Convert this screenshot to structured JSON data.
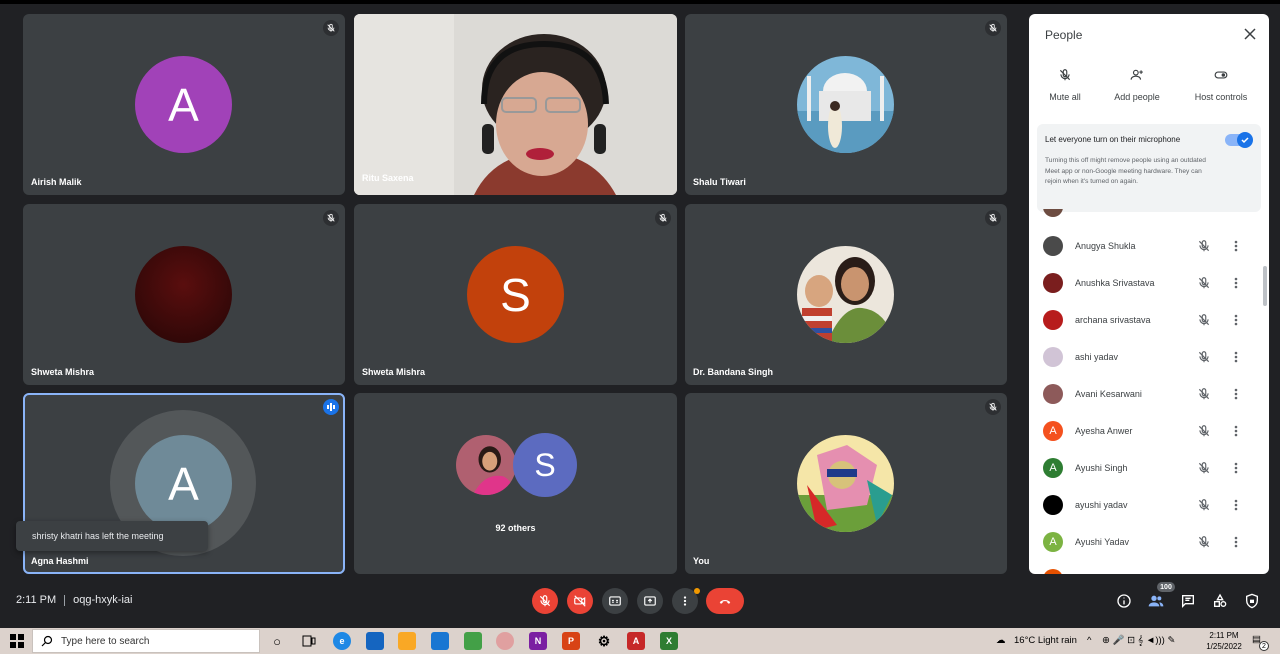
{
  "tiles": [
    {
      "name": "Airish Malik",
      "initial": "A",
      "color": "#a142b8"
    },
    {
      "name": "Ritu Saxena"
    },
    {
      "name": "Shalu Tiwari"
    },
    {
      "name": "Shweta Mishra",
      "color": "#5a0e0e"
    },
    {
      "name": "Shweta Mishra",
      "initial": "S",
      "color": "#c2410c"
    },
    {
      "name": "Dr. Bandana Singh"
    },
    {
      "name": "Agna Hashmi",
      "initial": "A",
      "color": "#6f8a98"
    },
    {
      "others": "92 others",
      "initial": "S",
      "color": "#5c6bc0"
    },
    {
      "name": "You"
    }
  ],
  "toast": "shristy khatri has left the meeting",
  "meeting": {
    "time": "2:11 PM",
    "code": "oqg-hxyk-iai"
  },
  "participants_badge": "100",
  "panel": {
    "title": "People",
    "actions": [
      {
        "label": "Mute all",
        "icon": "mic-off-icon"
      },
      {
        "label": "Add people",
        "icon": "person-add-icon"
      },
      {
        "label": "Host controls",
        "icon": "toggle-icon"
      }
    ],
    "mic_setting": {
      "label": "Let everyone turn on their microphone",
      "description": "Turning this off might remove people using an outdated Meet app or non-Google meeting hardware. They can rejoin when it's turned on again.",
      "enabled": true
    },
    "people": [
      {
        "name": "Anugya Shukla",
        "color": "#4a4a4a",
        "initial": ""
      },
      {
        "name": "Anushka Srivastava",
        "color": "#7a1e1e",
        "initial": ""
      },
      {
        "name": "archana srivastava",
        "color": "#b71c1c",
        "initial": ""
      },
      {
        "name": "ashi yadav",
        "color": "#d1c4d6",
        "initial": ""
      },
      {
        "name": "Avani Kesarwani",
        "color": "#8d5a5a",
        "initial": ""
      },
      {
        "name": "Ayesha Anwer",
        "color": "#f4511e",
        "initial": "A"
      },
      {
        "name": "Ayushi Singh",
        "color": "#2e7d32",
        "initial": "A"
      },
      {
        "name": "ayushi yadav",
        "color": "#000000",
        "initial": ""
      },
      {
        "name": "Ayushi Yadav",
        "color": "#7cb342",
        "initial": "A"
      }
    ]
  },
  "taskbar": {
    "search_placeholder": "Type here to search",
    "weather": "16°C  Light rain",
    "time": "2:11 PM",
    "date": "1/25/2022",
    "notifications": "2"
  }
}
